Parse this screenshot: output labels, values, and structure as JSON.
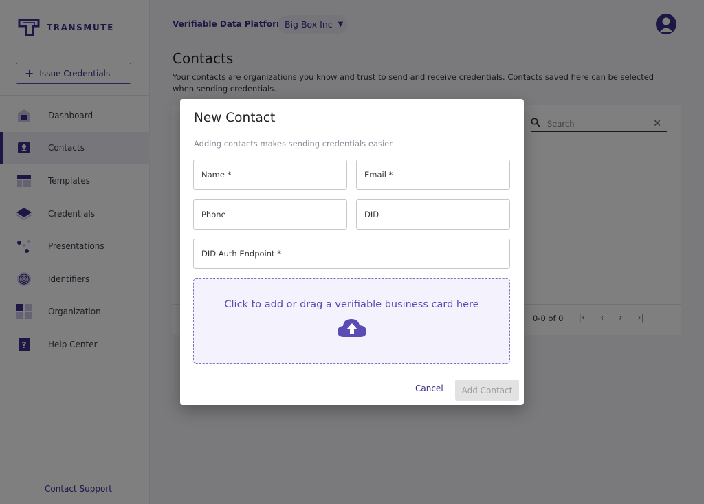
{
  "brand": {
    "name": "TRANSMUTE"
  },
  "sidebar": {
    "issue_button": {
      "label": "Issue Credentials"
    },
    "items": [
      {
        "label": "Dashboard",
        "icon": "dashboard-icon"
      },
      {
        "label": "Contacts",
        "icon": "contacts-icon",
        "active": true
      },
      {
        "label": "Templates",
        "icon": "templates-icon"
      },
      {
        "label": "Credentials",
        "icon": "credentials-icon"
      },
      {
        "label": "Presentations",
        "icon": "presentations-icon"
      },
      {
        "label": "Identifiers",
        "icon": "fingerprint-icon"
      },
      {
        "label": "Organization",
        "icon": "organization-icon"
      },
      {
        "label": "Help Center",
        "icon": "help-icon"
      }
    ],
    "footer_link": "Contact Support"
  },
  "header": {
    "platform": "Verifiable Data Platform",
    "organization": "Big Box Inc"
  },
  "page": {
    "title": "Contacts",
    "description": "Your contacts are organizations you know and trust to send and receive credentials. Contacts saved here can be selected when sending credentials."
  },
  "table": {
    "search_placeholder": "Search",
    "pagination": "0-0 of 0"
  },
  "modal": {
    "title": "New Contact",
    "subtitle": "Adding contacts makes sending credentials easier.",
    "fields": {
      "name": "Name *",
      "email": "Email *",
      "phone": "Phone",
      "did": "DID",
      "did_auth": "DID Auth Endpoint *"
    },
    "dropzone_text": "Click to add or drag a verifiable business card here",
    "cancel_label": "Cancel",
    "submit_label": "Add Contact"
  },
  "colors": {
    "brand": "#3a2f8a",
    "accent": "#5a4bb5",
    "dropzone_bg": "#f4f2fd"
  }
}
